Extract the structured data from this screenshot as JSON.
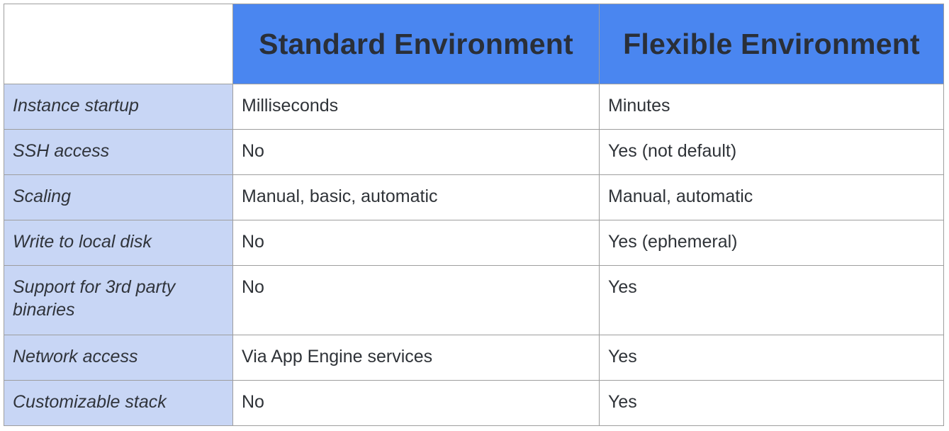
{
  "table": {
    "headers": [
      "",
      "Standard Environment",
      "Flexible Environment"
    ],
    "rows": [
      {
        "label": "Instance startup",
        "standard": "Milliseconds",
        "flexible": "Minutes"
      },
      {
        "label": "SSH access",
        "standard": "No",
        "flexible": "Yes (not default)"
      },
      {
        "label": "Scaling",
        "standard": "Manual, basic, automatic",
        "flexible": "Manual, automatic"
      },
      {
        "label": "Write to local disk",
        "standard": "No",
        "flexible": "Yes (ephemeral)"
      },
      {
        "label": "Support for 3rd party binaries",
        "standard": "No",
        "flexible": "Yes"
      },
      {
        "label": "Network access",
        "standard": "Via App Engine services",
        "flexible": "Yes"
      },
      {
        "label": "Customizable stack",
        "standard": "No",
        "flexible": "Yes"
      }
    ]
  },
  "colors": {
    "header_bg": "#4a86f0",
    "label_bg": "#c8d6f5",
    "border": "#9e9e9e"
  }
}
